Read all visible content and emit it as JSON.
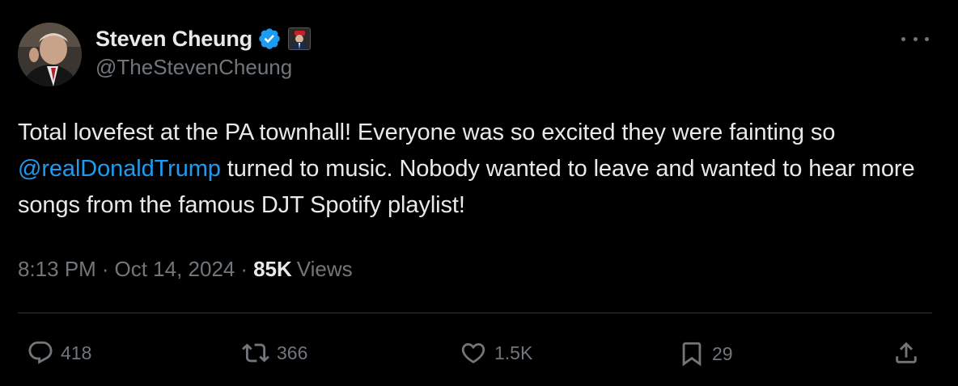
{
  "author": {
    "display_name": "Steven Cheung",
    "handle": "@TheStevenCheung",
    "verified": true
  },
  "tweet": {
    "text_part1": "Total lovefest at the PA townhall! Everyone was so excited they were fainting so ",
    "mention": "@realDonaldTrump",
    "text_part2": " turned to music. Nobody wanted to leave and wanted to hear more songs from the famous DJT Spotify playlist!"
  },
  "meta": {
    "time": "8:13 PM",
    "date": "Oct 14, 2024",
    "separator": "·",
    "views_count": "85K",
    "views_label": "Views"
  },
  "actions": {
    "replies": "418",
    "reposts": "366",
    "likes": "1.5K",
    "bookmarks": "29"
  },
  "icons": {
    "more": "more-horizontal-icon",
    "verified": "verified-badge-icon",
    "reply": "reply-icon",
    "repost": "repost-icon",
    "like": "heart-icon",
    "bookmark": "bookmark-icon",
    "share": "share-icon"
  },
  "colors": {
    "background": "#000000",
    "text": "#e7e9ea",
    "secondary": "#71767b",
    "accent": "#1d9bf0",
    "divider": "#2f3336"
  }
}
